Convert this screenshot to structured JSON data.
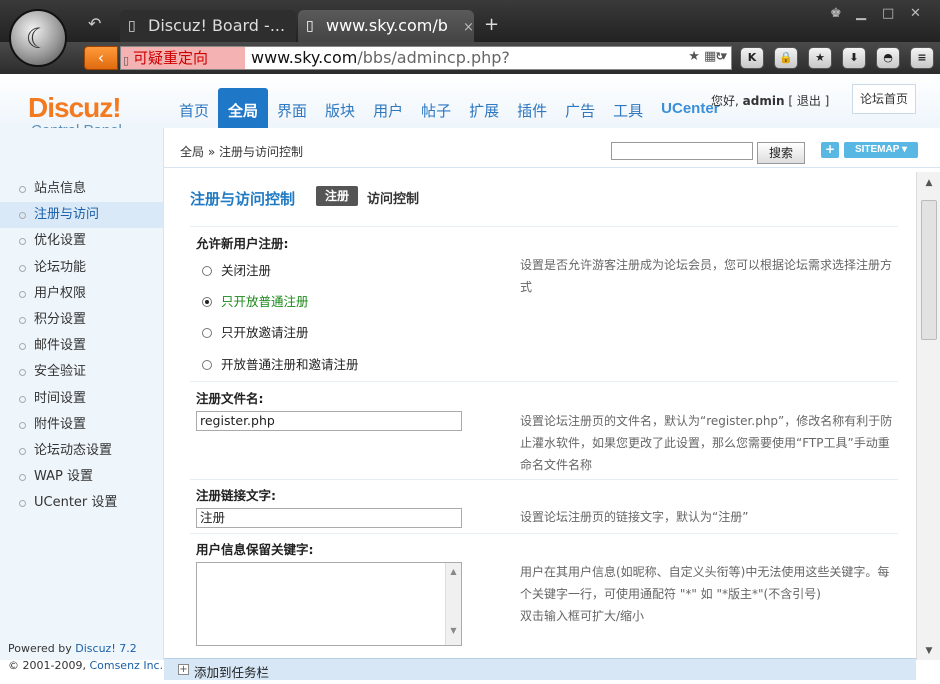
{
  "browser": {
    "tabs": [
      {
        "label": "Discuz! Board -...",
        "close": "×"
      },
      {
        "label": "www.sky.com/b",
        "close": "×"
      }
    ],
    "new_tab": "+",
    "redirect_label": "可疑重定向",
    "url_host": "www.sky.com",
    "url_path": "/bbs/admincp.php?"
  },
  "header": {
    "logo_main": "Discuz!",
    "logo_sub": "Control Panel",
    "nav": [
      "首页",
      "全局",
      "界面",
      "版块",
      "用户",
      "帖子",
      "扩展",
      "插件",
      "广告",
      "工具",
      "UCenter"
    ],
    "user_prefix": "您好,",
    "username": "admin",
    "logout": "[ 退出 ]",
    "home_button": "论坛首页"
  },
  "subbar": {
    "breadcrumb": "全局 » 注册与访问控制",
    "search_button": "搜索",
    "plus": "+",
    "sitemap": "SITEMAP"
  },
  "sidebar": {
    "items": [
      "站点信息",
      "注册与访问",
      "优化设置",
      "论坛功能",
      "用户权限",
      "积分设置",
      "邮件设置",
      "安全验证",
      "时间设置",
      "附件设置",
      "论坛动态设置",
      "WAP 设置",
      "UCenter 设置"
    ],
    "powered_by": "Powered by",
    "powered_product": "Discuz! 7.2",
    "copyright": "© 2001-2009,",
    "copyright_company": "Comsenz Inc."
  },
  "content": {
    "title": "注册与访问控制",
    "tab_active": "注册",
    "tab_other": "访问控制",
    "allow_register_label": "允许新用户注册:",
    "radio_options": [
      "关闭注册",
      "只开放普通注册",
      "只开放邀请注册",
      "开放普通注册和邀请注册"
    ],
    "allow_register_help": "设置是否允许游客注册成为论坛会员，您可以根据论坛需求选择注册方式",
    "register_file_label": "注册文件名:",
    "register_file_value": "register.php",
    "register_file_help": "设置论坛注册页的文件名，默认为“register.php”，修改名称有利于防止灌水软件，如果您更改了此设置，那么您需要使用“FTP工具”手动重命名文件名称",
    "register_link_label": "注册链接文字:",
    "register_link_value": "注册",
    "register_link_help": "设置论坛注册页的链接文字，默认为“注册”",
    "reserved_keywords_label": "用户信息保留关键字:",
    "reserved_keywords_help": "用户在其用户信息(如昵称、自定义头衔等)中无法使用这些关键字。每个关键字一行，可使用通配符 \"*\" 如 \"*版主*\"(不含引号)",
    "reserved_keywords_help2": "双击输入框可扩大/缩小"
  },
  "statusbar": {
    "add_to_taskbar": "添加到任务栏"
  }
}
